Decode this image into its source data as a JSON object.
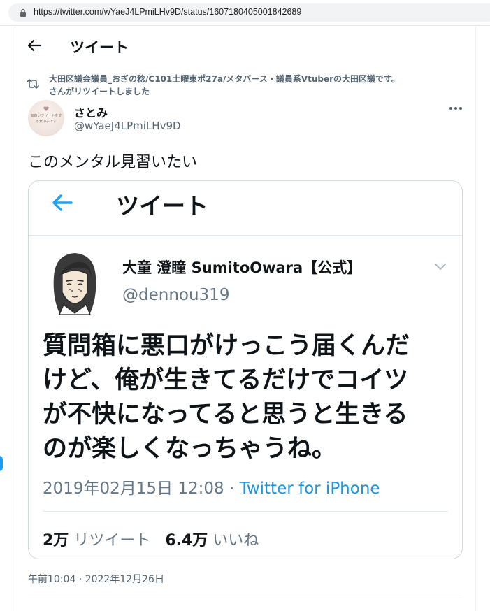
{
  "browser": {
    "url": "https://twitter.com/wYaeJ4LPmiLHv9D/status/1607180405001842689"
  },
  "header": {
    "title": "ツイート"
  },
  "retweet_context": {
    "line1": "大田区議会議員_おぎの稔/C101土曜東ポ27a/メタバース・議員系Vtuberの大田区議です。",
    "line2": "さんがリツイートしました"
  },
  "author": {
    "name": "さとみ",
    "handle": "@wYaeJ4LPmiLHv9D",
    "avatar_text_1": "面白いツイートをす",
    "avatar_text_2": "る女の子です"
  },
  "tweet": {
    "text": "このメンタル見習いたい",
    "timestamp": "午前10:04 · 2022年12月26日"
  },
  "embedded": {
    "header_title": "ツイート",
    "name": "大童 澄瞳 SumitoOwara【公式】",
    "handle": "@dennou319",
    "body_lines": [
      "質問箱に悪口がけっこう届くんだ",
      "けど、俺が生きてるだけでコイツ",
      "が不快になってると思うと生きる",
      "のが楽しくなっちゃうね。"
    ],
    "date": "2019年02月15日 12:08 · ",
    "source": "Twitter for iPhone",
    "retweet_count": "2万",
    "retweet_label": "リツイート",
    "like_count": "6.4万",
    "like_label": "いいね"
  },
  "colors": {
    "accent": "#1d9bf0",
    "secondary_text": "#536471",
    "embedded_link": "#1b95e0"
  },
  "icons": [
    "lock-icon",
    "back-arrow-icon",
    "retweet-icon",
    "more-icon",
    "chevron-down-icon"
  ]
}
